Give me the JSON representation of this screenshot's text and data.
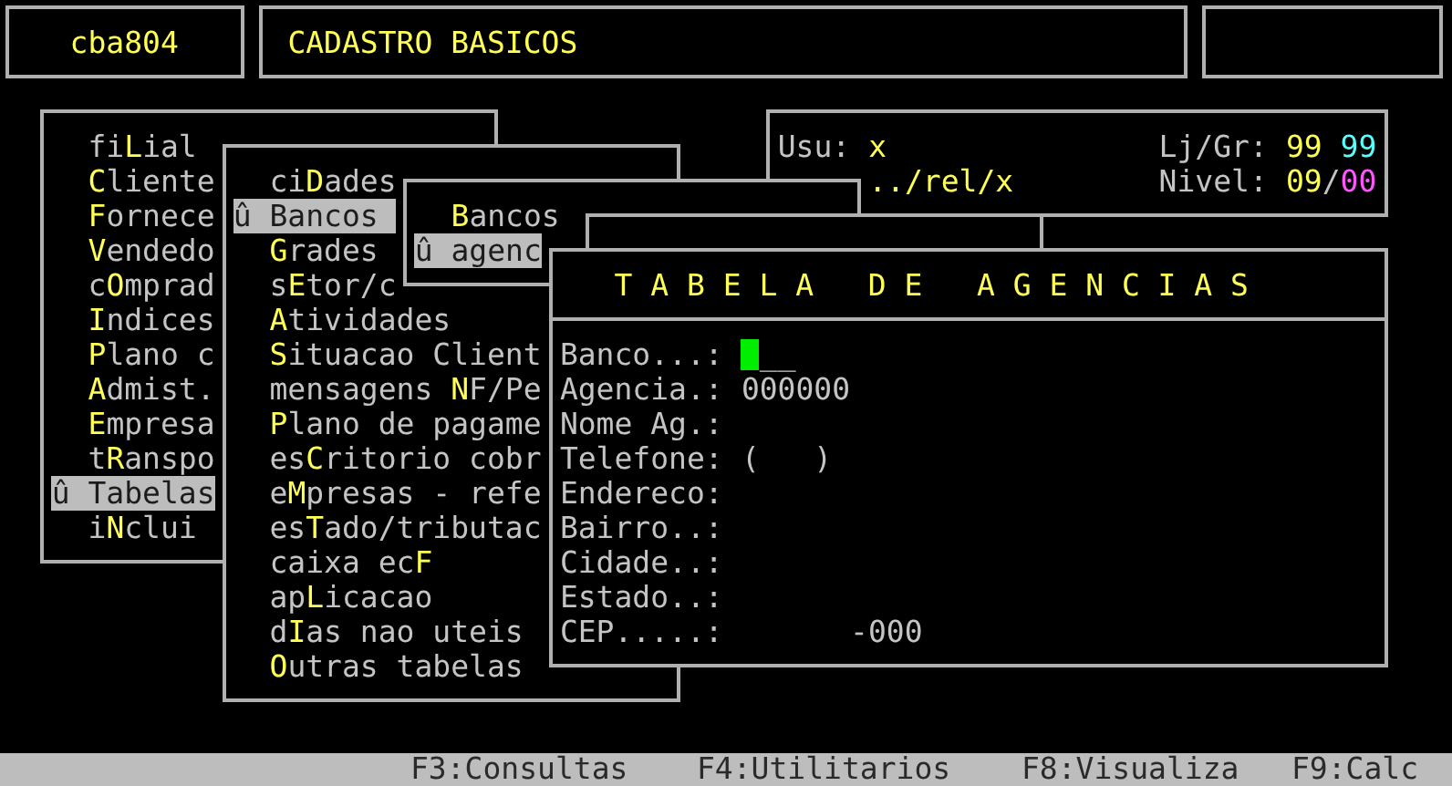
{
  "header": {
    "program": "cba804",
    "title": "CADASTRO BASICOS"
  },
  "main_menu": {
    "items": [
      {
        "label": "fi**L**ial",
        "selected": false
      },
      {
        "label": "**C**liente",
        "selected": false
      },
      {
        "label": "**F**ornece",
        "selected": false
      },
      {
        "label": "**V**endedo",
        "selected": false
      },
      {
        "label": "c**O**mprad",
        "selected": false
      },
      {
        "label": "**I**ndices",
        "selected": false
      },
      {
        "label": "**P**lano c",
        "selected": false
      },
      {
        "label": "**A**dmist.",
        "selected": false
      },
      {
        "label": "**E**mpresa",
        "selected": false
      },
      {
        "label": "t**R**anspo",
        "selected": false
      },
      {
        "label": "û Tabelas",
        "selected": true
      },
      {
        "label": "i**N**clui",
        "selected": false
      }
    ]
  },
  "session": {
    "user_label": "Usu:",
    "user": "x",
    "path": "../rel/x",
    "store_label": "Lj/Gr:",
    "store": "99",
    "group": "99",
    "access_label": "Nivel:",
    "access_level": "09",
    "access_separator": "/",
    "access_max": "00"
  },
  "submenu": {
    "items": [
      {
        "label": "ci**D**ades",
        "selected": false
      },
      {
        "label": "û Bancos",
        "selected": true
      },
      {
        "label": "**G**rades",
        "selected": false
      },
      {
        "label": "s**E**tor/c",
        "selected": false
      },
      {
        "label": "**A**tividades",
        "selected": false
      },
      {
        "label": "**S**ituacao Client",
        "selected": false
      },
      {
        "label": "mensagens **N**F/Pe",
        "selected": false
      },
      {
        "label": "**P**lano de pagame",
        "selected": false
      },
      {
        "label": "es**C**ritorio cobr",
        "selected": false
      },
      {
        "label": "e**M**presas - refe",
        "selected": false
      },
      {
        "label": "es**T**ado/tributac",
        "selected": false
      },
      {
        "label": "caixa ec**F**",
        "selected": false
      },
      {
        "label": "ap**L**icacao",
        "selected": false
      },
      {
        "label": "d**I**as nao uteis",
        "selected": false
      },
      {
        "label": "**O**utras tabelas",
        "selected": false
      }
    ]
  },
  "bancos_menu": {
    "items": [
      {
        "label": "**B**ancos",
        "selected": false
      },
      {
        "label": "û agenc",
        "selected": true
      }
    ]
  },
  "form": {
    "title": "T A B E L A   D E   A G E N C I A S",
    "fields": [
      {
        "label": "Banco...:",
        "value": "__",
        "cursor": true
      },
      {
        "label": "Agencia.:",
        "value": "000000",
        "cursor": false
      },
      {
        "label": "Nome Ag.:",
        "cursor": false
      },
      {
        "label": "Telefone:",
        "value": "(   )",
        "cursor": false
      },
      {
        "label": "Endereco:",
        "cursor": false
      },
      {
        "label": "Bairro..:",
        "cursor": false
      },
      {
        "label": "Cidade..:",
        "cursor": false
      },
      {
        "label": "Estado..:",
        "cursor": false
      },
      {
        "label": "CEP.....:",
        "value": "      -000",
        "cursor": false
      }
    ]
  },
  "status_bar": {
    "items": [
      "F3:Consultas",
      "F4:Utilitarios",
      "F8:Visualiza",
      "F9:Calc"
    ]
  }
}
